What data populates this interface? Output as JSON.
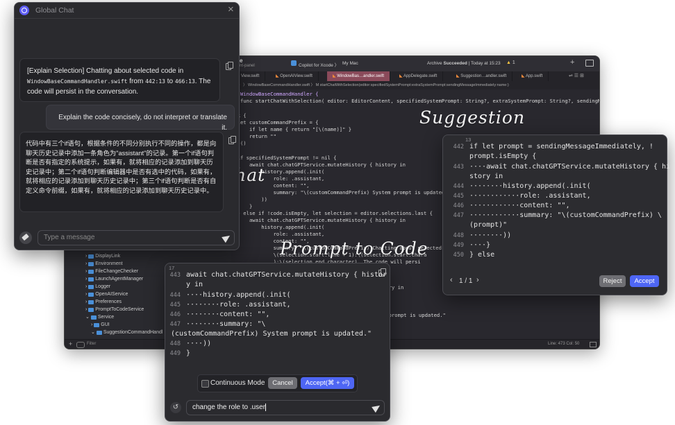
{
  "labels": {
    "chat": "Chat",
    "suggestion": "Suggestion",
    "prompt_to_code": "Prompt to Code"
  },
  "xcode": {
    "title_left": "e",
    "title_sub": "nt-panel",
    "scheme": "Copilot for Xcode 〉",
    "destination": "My Mac",
    "status_prefix": "Archive",
    "status_bold": "Succeeded",
    "status_suffix": "| Today at 15:23",
    "warning_count": "1",
    "tabs": [
      "View.swift",
      "OpenAIView.swift",
      "WindowBas…andler.swift",
      "AppDelegate.swift",
      "Suggestion…andler.swift",
      "App.swift"
    ],
    "path": "〉 〉 WindowBaseCommandHandler.swift 〉 M startChatWithSelection(editor:specifiedSystemPrompt:extraSystemPrompt:sendingMessageImmediately:name:)",
    "status_bar_right": "Line: 473  Col: 50",
    "filter_label": "Filter",
    "nav_items": [
      "DisplayLink",
      "Environment",
      "FileChangeChecker",
      "LaunchAgentManager",
      "Logger",
      "OpenAIService",
      "Preferences",
      "PromptToCodeService",
      "Service",
      "GUI",
      "SuggestionCommandHandl"
    ],
    "code": {
      "l1": "WindowBaseCommandHandler {",
      "l2": "le func startChatWithSelection( editor: EditorContent, specifiedSystemPrompt: String?, extraSystemPrompt: String?, sendingM…",
      "l3": "ask {",
      "l4": "  let customCommandPrefix = {",
      "l5": "      if let name { return \"[\\(name)]\" }",
      "l6": "      return \"\"",
      "l7": "  }()",
      "l8": "  if specifiedSystemPrompt != nil {",
      "l9": "      await chat.chatGPTService.mutateHistory { history in",
      "l10": "          history.append(.init(",
      "l11": "              role: .assistant,",
      "l12": "              content: \"\",",
      "l13": "              summary: \"\\(customCommandPrefix) System prompt is updated.\"",
      "l14": "          ))",
      "l15": "      }",
      "l16": "  } else if !code.isEmpty, let selection = editor.selections.last {",
      "l17": "      await chat.chatGPTService.mutateHistory { history in",
      "l18": "          history.append(.init(",
      "l19": "              role: .assistant,",
      "l20": "              content: \"\",",
      "l21": "              summary: \"\\(customCommandPrefix) Chatting about selected",
      "l22": "              \\(selection.start.line + 1):\\(selection.start.chara",
      "l23": "              ):\\(selection.end.character). The code will persi",
      "l24": "tory in",
      "l25": "m prompt is updated.\""
    }
  },
  "chat": {
    "title": "Global Chat",
    "close": "×",
    "msg1_part1": "[Explain Selection] Chatting about selected code in ",
    "msg1_code1": "WindowBaseCommandHandler.swift",
    "msg1_part2": " from ",
    "msg1_code2": "442:13",
    "msg1_part3": " to ",
    "msg1_code3": "466:13",
    "msg1_part4": ". The code will persist in the conversation.",
    "user_msg": "Explain the code concisely, do not interpret or translate it.",
    "reply": "代码中有三个if语句，根据条件的不同分别执行不同的操作，都是向聊天历史记录中添加一条角色为\"assistant\"的记录。第一个if语句判断是否有指定的系统提示，如果有，就将相应的记录添加到聊天历史记录中；第二个if语句判断编辑器中是否有选中的代码，如果有，就将相应的记录添加到聊天历史记录中；第三个if语句判断是否有自定义命令前缀，如果有，就将相应的记录添加到聊天历史记录中。",
    "input_placeholder": "Type a message"
  },
  "suggestion": {
    "top_num": "13",
    "lines": [
      {
        "n": "442",
        "t": "if let prompt = sendingMessageImmediately, !"
      },
      {
        "n": "",
        "t": "prompt.isEmpty {"
      },
      {
        "n": "443",
        "t": "····await chat.chatGPTService.mutateHistory { hi"
      },
      {
        "n": "",
        "t": "story in"
      },
      {
        "n": "444",
        "t": "········history.append(.init("
      },
      {
        "n": "445",
        "t": "············role: .assistant,"
      },
      {
        "n": "446",
        "t": "············content: \"\","
      },
      {
        "n": "447",
        "t": "············summary: \"\\(customCommandPrefix) \\"
      },
      {
        "n": "",
        "t": "(prompt)\""
      },
      {
        "n": "448",
        "t": "········))"
      },
      {
        "n": "449",
        "t": "····}"
      },
      {
        "n": "450",
        "t": "} else"
      }
    ],
    "pager": "1 / 1",
    "reject": "Reject",
    "accept": "Accept"
  },
  "prompt_to_code": {
    "top_num": "17",
    "lines": [
      {
        "n": "443",
        "t": "await chat.chatGPTService.mutateHistory { histor"
      },
      {
        "n": "",
        "t": "y in"
      },
      {
        "n": "444",
        "t": "····history.append(.init("
      },
      {
        "n": "445",
        "t": "········role: .assistant,"
      },
      {
        "n": "446",
        "t": "········content: \"\","
      },
      {
        "n": "447",
        "t": "········summary: \"\\"
      },
      {
        "n": "",
        "t": "(customCommandPrefix) System prompt is updated.\""
      },
      {
        "n": "448",
        "t": "····))"
      },
      {
        "n": "449",
        "t": "}"
      }
    ],
    "continuous_mode": "Continuous Mode",
    "cancel": "Cancel",
    "accept": "Accept(⌘ + ⏎)",
    "input_value": "change the role to .user"
  }
}
